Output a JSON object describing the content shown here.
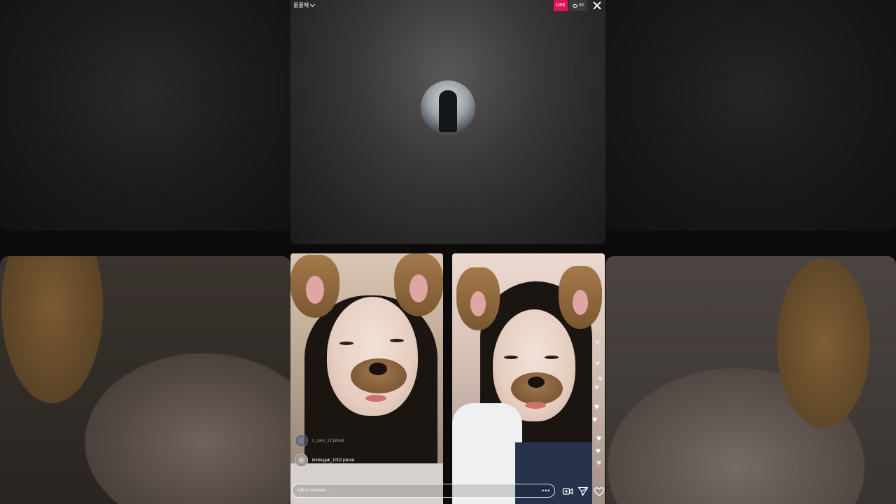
{
  "host": {
    "username": "꿀꿀해",
    "live_label": "LIVE",
    "viewer_count": "93"
  },
  "activity": [
    {
      "text": "x_zure_12 joined"
    },
    {
      "text": "kimbugak_1002 joined"
    }
  ],
  "composer": {
    "placeholder": "Add a comment ..."
  },
  "colors": {
    "live_badge": "#e0125e",
    "background": "#0b0b0b"
  },
  "icons": [
    "chevron-down-icon",
    "eye-icon",
    "close-icon",
    "more-icon",
    "video-add-icon",
    "send-icon",
    "heart-icon"
  ]
}
